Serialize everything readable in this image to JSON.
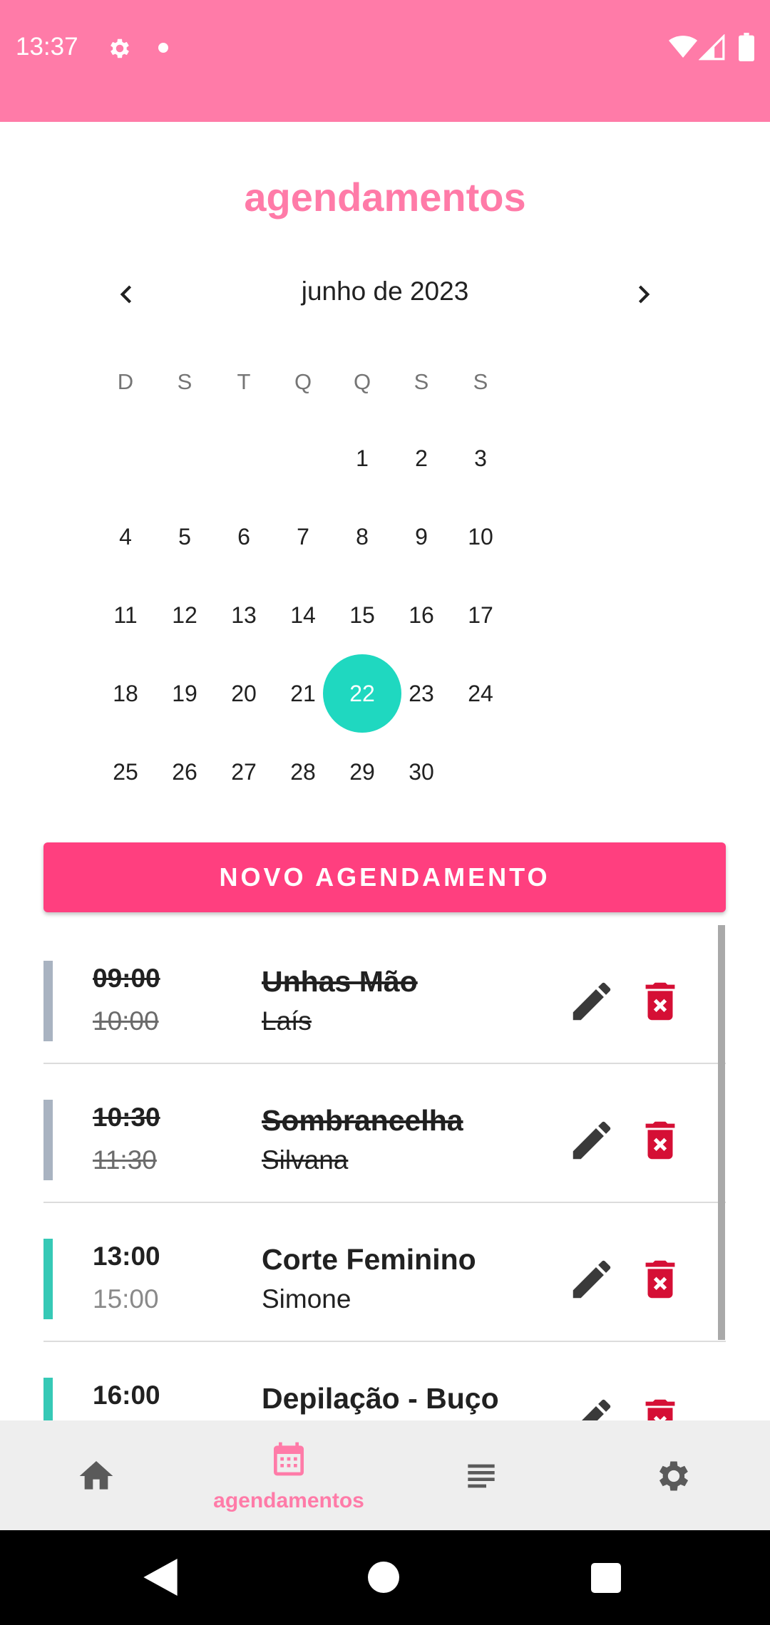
{
  "status_bar": {
    "time": "13:37",
    "icons": [
      "gear-icon",
      "notification-dot",
      "wifi-icon",
      "signal-icon",
      "battery-icon"
    ],
    "background": "#ff7ba8"
  },
  "title": "agendamentos",
  "calendar": {
    "month_label": "junho de 2023",
    "weekdays": [
      "D",
      "S",
      "T",
      "Q",
      "Q",
      "S",
      "S"
    ],
    "weeks": [
      [
        "",
        "",
        "",
        "",
        "1",
        "2",
        "3"
      ],
      [
        "4",
        "5",
        "6",
        "7",
        "8",
        "9",
        "10"
      ],
      [
        "11",
        "12",
        "13",
        "14",
        "15",
        "16",
        "17"
      ],
      [
        "18",
        "19",
        "20",
        "21",
        "22",
        "23",
        "24"
      ],
      [
        "25",
        "26",
        "27",
        "28",
        "29",
        "30",
        ""
      ]
    ],
    "selected_day": "22",
    "selected_color": "#1fd8c0"
  },
  "new_button": {
    "label": "NOVO AGENDAMENTO",
    "color": "#ff3f7f"
  },
  "appointments": [
    {
      "start": "09:00",
      "end": "10:00",
      "service": "Unhas Mão",
      "client": "Laís",
      "done": true,
      "bar_color": "#a9b3c1"
    },
    {
      "start": "10:30",
      "end": "11:30",
      "service": "Sombrancelha",
      "client": "Silvana",
      "done": true,
      "bar_color": "#a9b3c1"
    },
    {
      "start": "13:00",
      "end": "15:00",
      "service": "Corte Feminino",
      "client": "Simone",
      "done": false,
      "bar_color": "#36c9b6"
    },
    {
      "start": "16:00",
      "end": "",
      "service": "Depilação - Buço",
      "client": "",
      "done": false,
      "bar_color": "#36c9b6"
    }
  ],
  "actions": {
    "edit_icon": "pencil-icon",
    "delete_icon": "trash-icon",
    "delete_color": "#d50f35"
  },
  "bottom_nav": [
    {
      "icon": "home-icon",
      "label": ""
    },
    {
      "icon": "calendar-icon",
      "label": "agendamentos",
      "active": true
    },
    {
      "icon": "list-icon",
      "label": ""
    },
    {
      "icon": "settings-icon",
      "label": ""
    }
  ],
  "accent": "#ff7ba8"
}
